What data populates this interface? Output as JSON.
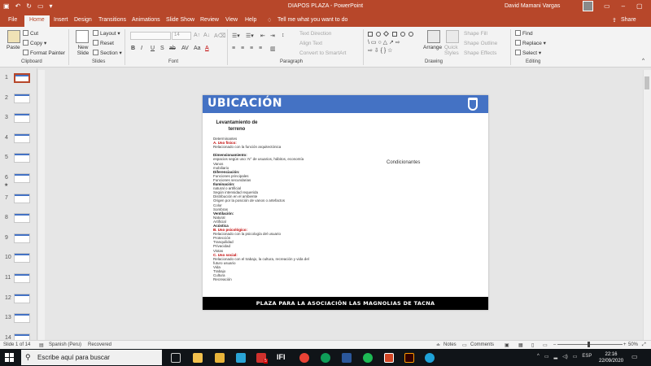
{
  "titlebar": {
    "doc_title": "DIAPOS PLAZA  -  PowerPoint",
    "user": "David Mamani Vargas"
  },
  "tabs": [
    "File",
    "Home",
    "Insert",
    "Design",
    "Transitions",
    "Animations",
    "Slide Show",
    "Review",
    "View",
    "Help"
  ],
  "tell_me": "Tell me what you want to do",
  "share": "Share",
  "ribbon": {
    "clipboard": {
      "paste": "Paste",
      "cut": "Cut",
      "copy": "Copy",
      "format_painter": "Format Painter",
      "label": "Clipboard"
    },
    "slides": {
      "new_slide": "New Slide",
      "layout": "Layout",
      "reset": "Reset",
      "section": "Section",
      "label": "Slides"
    },
    "font": {
      "size": "14",
      "label": "Font",
      "bold": "B",
      "italic": "I",
      "underline": "U",
      "strike": "S",
      "shadow": "ab",
      "spacing": "AV",
      "case": "Aa",
      "color": "A"
    },
    "paragraph": {
      "text_direction": "Text Direction",
      "align_text": "Align Text",
      "smartart": "Convert to SmartArt",
      "label": "Paragraph"
    },
    "drawing": {
      "arrange": "Arrange",
      "quick_styles": "Quick Styles",
      "shape_fill": "Shape Fill",
      "shape_outline": "Shape Outline",
      "shape_effects": "Shape Effects",
      "label": "Drawing"
    },
    "editing": {
      "find": "Find",
      "replace": "Replace",
      "select": "Select",
      "label": "Editing"
    }
  },
  "thumbnails": [
    "1",
    "2",
    "3",
    "4",
    "5",
    "6",
    "7",
    "8",
    "9",
    "10",
    "11",
    "12",
    "13",
    "14"
  ],
  "slide": {
    "title": "UBICACIÓN",
    "subtitle": "Levantamiento de terreno",
    "content": [
      {
        "text": "Determinantes",
        "style": "n"
      },
      {
        "text": "A.   Uso físico:",
        "style": "red"
      },
      {
        "text": "Relacionado con la función arquitectónica",
        "style": "n"
      },
      {
        "text": "",
        "style": "n"
      },
      {
        "text": "Dimensionamiento:",
        "style": "h"
      },
      {
        "text": "espacios según uso: N° de usuarios, hábitos, economía",
        "style": "n"
      },
      {
        "text": "Vanos",
        "style": "n"
      },
      {
        "text": "mobiliario",
        "style": "n"
      },
      {
        "text": "Diferenciación:",
        "style": "h"
      },
      {
        "text": "Funciones principales",
        "style": "n"
      },
      {
        "text": "Funciones secundarias",
        "style": "n"
      },
      {
        "text": "Iluminación:",
        "style": "h"
      },
      {
        "text": "natural o artificial",
        "style": "n"
      },
      {
        "text": "Según intensidad requerida",
        "style": "n"
      },
      {
        "text": "Distribución en el ambiente",
        "style": "n"
      },
      {
        "text": "Origen por la posición de vanos o artefactos",
        "style": "n"
      },
      {
        "text": "Color",
        "style": "n"
      },
      {
        "text": "Sombras",
        "style": "n"
      },
      {
        "text": "Ventilación:",
        "style": "h"
      },
      {
        "text": "Natural",
        "style": "n"
      },
      {
        "text": "Artificial",
        "style": "n"
      },
      {
        "text": "Acústica",
        "style": "h"
      },
      {
        "text": "B.   Uso psicológico:",
        "style": "red"
      },
      {
        "text": "Relacionado con la psicología del usuario",
        "style": "n"
      },
      {
        "text": "Protección",
        "style": "n"
      },
      {
        "text": "Tranquilidad",
        "style": "n"
      },
      {
        "text": "Privacidad",
        "style": "n"
      },
      {
        "text": "Vistas",
        "style": "n"
      },
      {
        "text": "C.  Uso social:",
        "style": "red"
      },
      {
        "text": "Relacionado con el trabajo, la cultura, recreación y vida del",
        "style": "n"
      },
      {
        "text": "futuro usuario",
        "style": "n"
      },
      {
        "text": "Vida",
        "style": "n"
      },
      {
        "text": "Trabajo",
        "style": "n"
      },
      {
        "text": "Cultura",
        "style": "n"
      },
      {
        "text": "Recreación",
        "style": "n"
      }
    ],
    "condicionantes": "Condicionantes",
    "footer": "PLAZA PARA LA ASOCIACIÓN LAS MAGNOLIAS DE TACNA"
  },
  "status": {
    "slide_of": "Slide 1 of 14",
    "language": "Spanish (Peru)",
    "recovered": "Recovered",
    "notes": "Notes",
    "comments": "Comments",
    "zoom": "50%"
  },
  "taskbar": {
    "search_placeholder": "Escribe aquí para buscar",
    "badge": "5",
    "lang": "ESP",
    "time": "22:16",
    "date": "22/09/2020"
  },
  "colors": {
    "accent": "#b7472a",
    "slide_header": "#4472c4",
    "footer_bar": "#000000",
    "highlight_red": "#c00000"
  }
}
